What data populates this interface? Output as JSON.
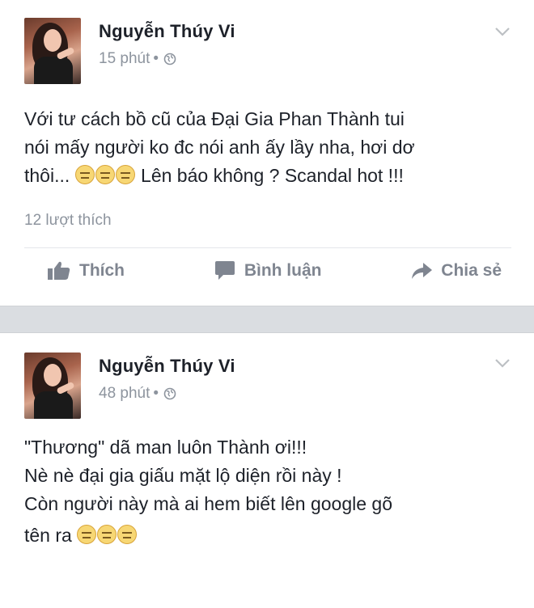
{
  "posts": [
    {
      "author": "Nguyễn Thúy Vi",
      "time": "15 phút",
      "text_lines": [
        "Với tư cách bồ cũ của Đại Gia Phan Thành tui",
        "nói mấy người ko đc nói anh ấy lầy nha, hơi dơ",
        "thôi..."
      ],
      "text_tail": " Lên báo không ? Scandal hot !!!",
      "likes": "12 lượt thích",
      "actions": {
        "like": "Thích",
        "comment": "Bình luận",
        "share": "Chia sẻ"
      }
    },
    {
      "author": "Nguyễn Thúy Vi",
      "time": "48 phút",
      "text_lines": [
        "\"Thương\" dã man luôn Thành ơi!!!",
        "Nè nè đại gia giấu mặt lộ diện rồi này !",
        "Còn người này mà ai hem biết lên google gõ",
        "tên ra"
      ]
    }
  ],
  "meta_separator": "•",
  "icons": {
    "privacy": "globe-icon",
    "menu": "chevron-down-icon",
    "like": "thumbs-up-icon",
    "comment": "comment-icon",
    "share": "share-arrow-icon",
    "emoji": "neutral-face-emoji"
  },
  "colors": {
    "text": "#1d2129",
    "muted": "#8d949e",
    "separator": "#dadde1"
  }
}
